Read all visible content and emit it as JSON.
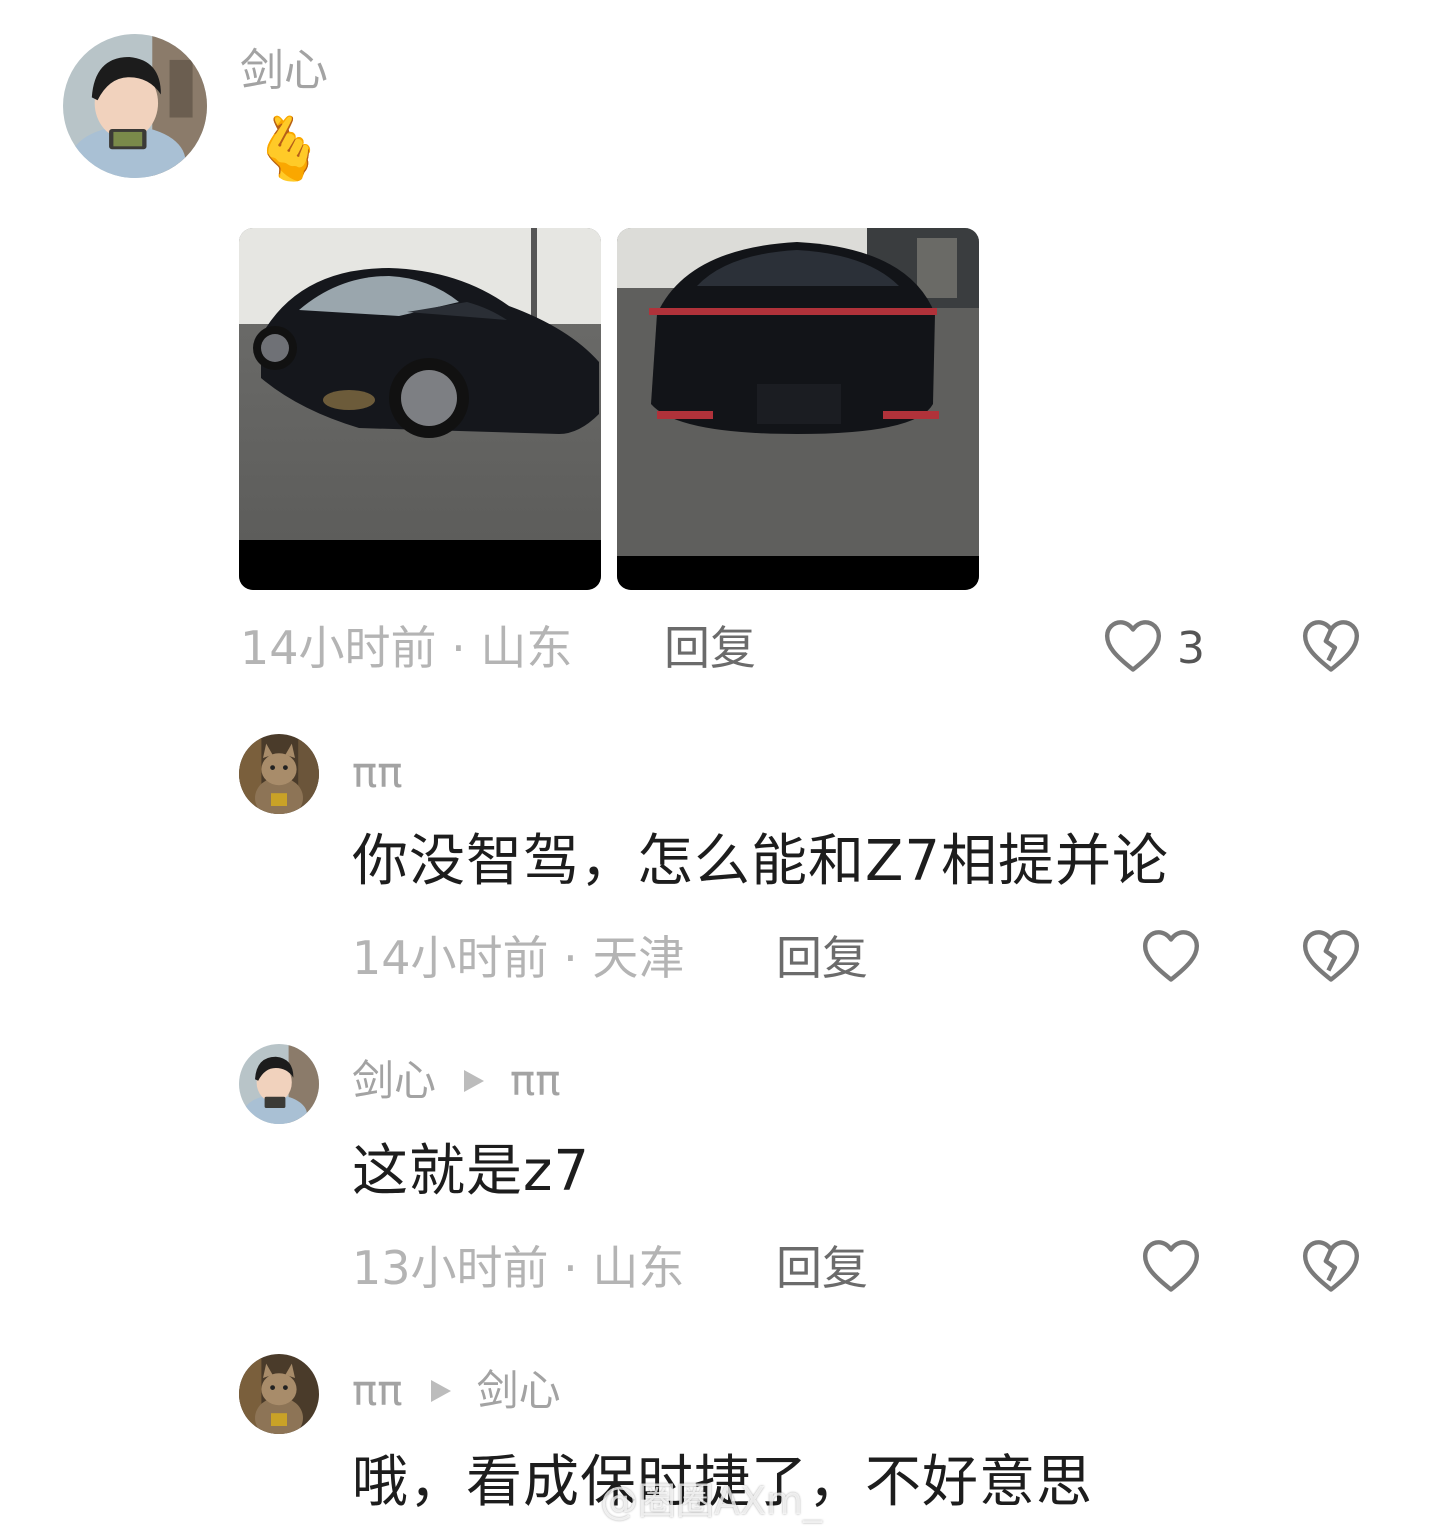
{
  "comments": [
    {
      "author": "剑心",
      "emoji": "🫰",
      "meta": "14小时前 · 山东",
      "reply_label": "回复",
      "like_count": "3",
      "images": [
        "car-front-three-quarter-photo",
        "car-rear-photo"
      ]
    },
    {
      "author": "ππ",
      "text": "你没智驾，怎么能和Z7相提并论",
      "meta": "14小时前 · 天津",
      "reply_label": "回复"
    },
    {
      "author": "剑心",
      "reply_to": "ππ",
      "text": "这就是z7",
      "meta": "13小时前 · 山东",
      "reply_label": "回复"
    },
    {
      "author": "ππ",
      "reply_to": "剑心",
      "text": "哦，看成保时捷了，不好意思"
    }
  ],
  "watermark": "@圈圈AXm_",
  "icons": {
    "like": "heart-outline-icon",
    "dislike": "broken-heart-icon",
    "reply_arrow": "play-triangle-icon"
  },
  "colors": {
    "meta": "#b4b4b4",
    "text": "#1d1d1d",
    "icon": "#7a7a7a"
  }
}
